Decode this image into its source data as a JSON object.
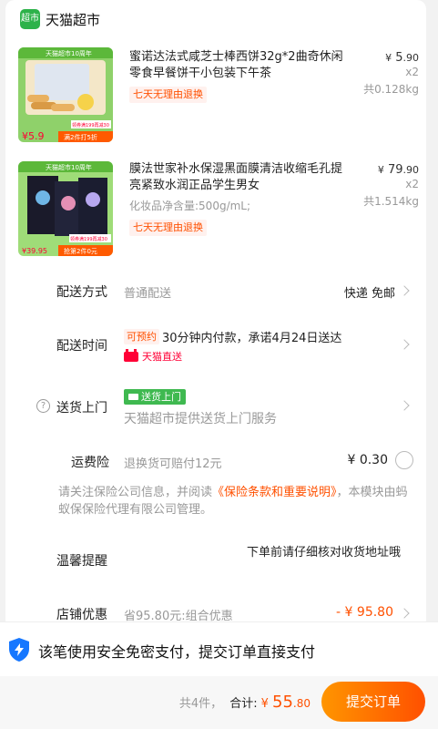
{
  "store": {
    "logo_text": "超市",
    "name": "天猫超市"
  },
  "products": [
    {
      "title": "蜜诺达法式咸芝士棒西饼32g*2曲奇休闲零食早餐饼干小包装下午茶",
      "price_symbol": "¥",
      "price_int": "5",
      "price_dec": ".90",
      "qty": "x2",
      "weight": "共0.128kg",
      "return_tag": "七天无理由退换",
      "thumb": {
        "banner": "天猫超市10周年",
        "promo": "领券满199再减30",
        "price": "¥5.9",
        "footer": "满2件打5折"
      }
    },
    {
      "title": "膜法世家补水保湿黑面膜清洁收缩毛孔提亮紧致水润正品学生男女",
      "price_symbol": "¥",
      "price_int": "79",
      "price_dec": ".90",
      "qty": "x2",
      "weight": "共1.514kg",
      "spec": "化妆品净含量:500g/mL;",
      "return_tag": "七天无理由退换",
      "thumb": {
        "banner": "天猫超市10周年",
        "promo": "领券满199再减30",
        "price": "¥39.95",
        "footer": "抢第2件0元"
      }
    }
  ],
  "delivery_method": {
    "label": "配送方式",
    "value": "普通配送",
    "right": "快递 免邮"
  },
  "delivery_time": {
    "label": "配送时间",
    "badge": "可预约",
    "text": "30分钟内付款，承诺4月24日送达",
    "service": "天猫直送"
  },
  "door_delivery": {
    "label": "送货上门",
    "badge": "送货上门",
    "desc": "天猫超市提供送货上门服务"
  },
  "insurance": {
    "label": "运费险",
    "desc": "退换货可赔付12元",
    "price": "¥ 0.30",
    "notice_pre": "请关注保险公司信息，并阅读",
    "notice_link": "《保险条款和重要说明》",
    "notice_post": "，本模块由蚂蚁保保险代理有限公司管理。"
  },
  "reminder": {
    "label": "温馨提醒",
    "value": "下单前请仔细核对收货地址哦"
  },
  "shop_discount": {
    "label": "店铺优惠",
    "desc": "省95.80元:组合优惠",
    "amount": "- ¥ 95.80"
  },
  "secure_pay": {
    "text": "该笔使用安全免密支付，提交订单直接支付"
  },
  "footer": {
    "count": "共4件，",
    "sum_label": "合计:",
    "currency": "¥",
    "total_int": "55",
    "total_dec": ".80",
    "submit": "提交订单"
  },
  "colors": {
    "accent": "#ff5000",
    "tmall_red": "#ff0036",
    "green": "#3fb950"
  }
}
